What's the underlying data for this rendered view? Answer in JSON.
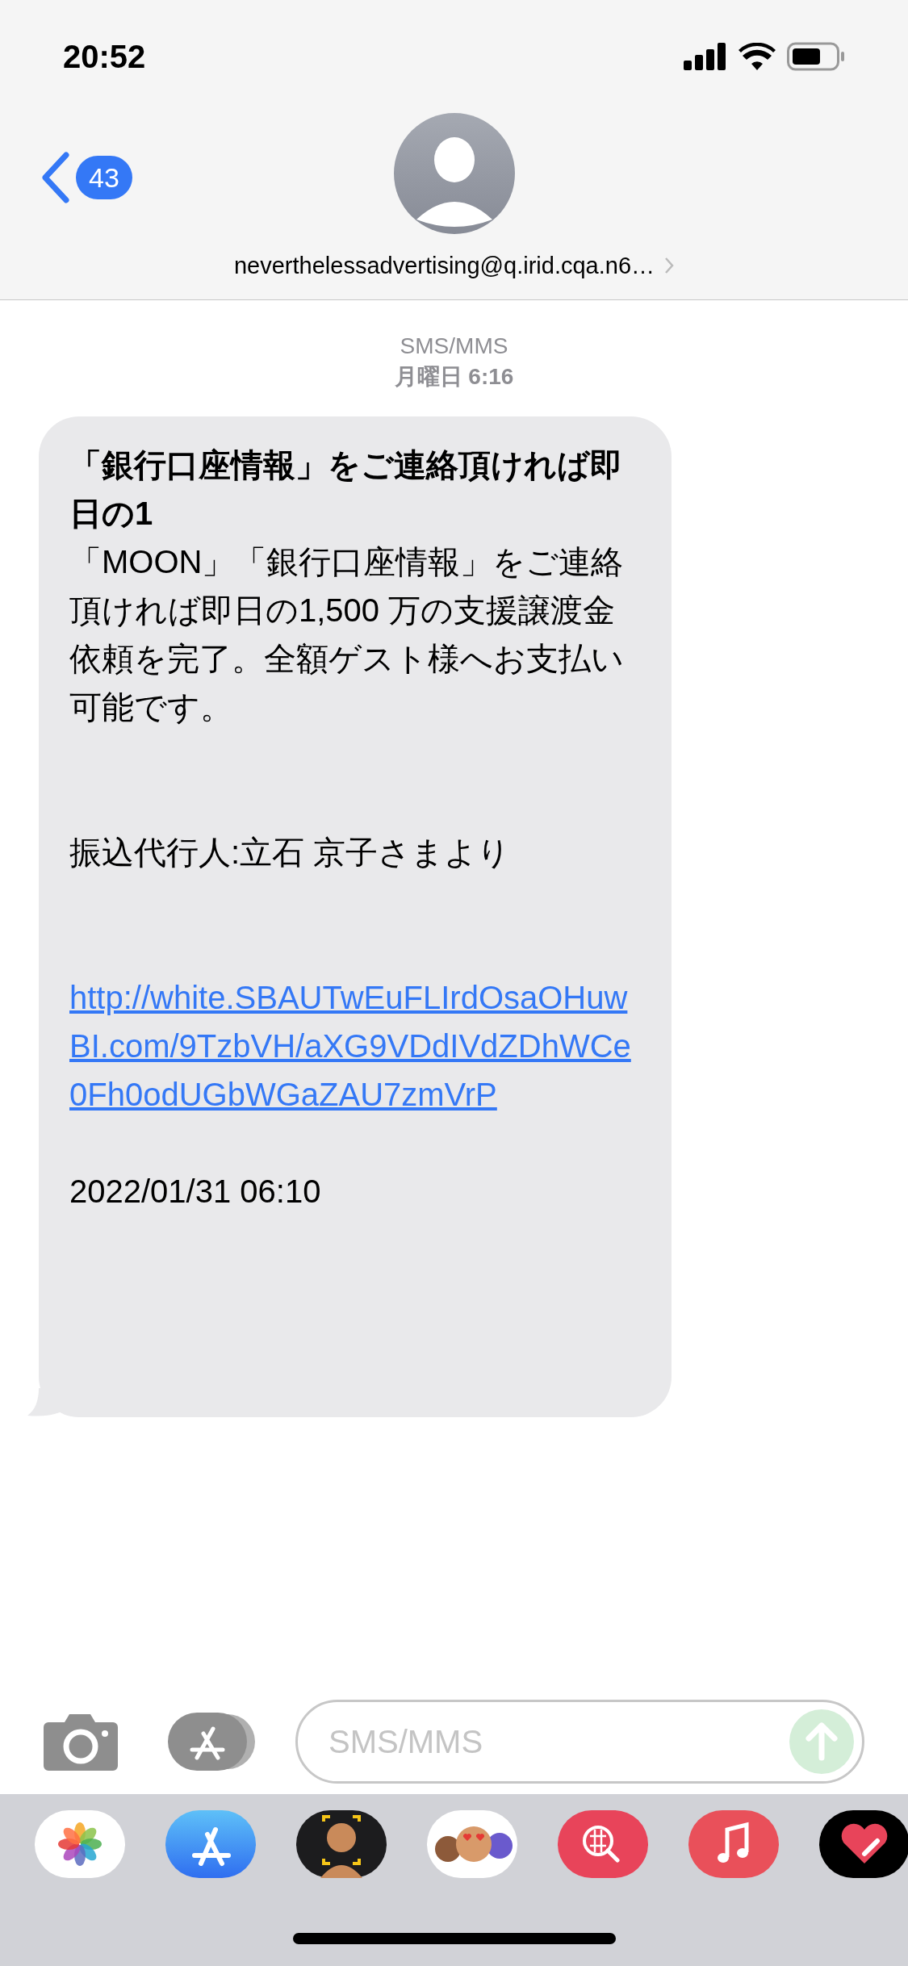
{
  "status_bar": {
    "time": "20:52"
  },
  "header": {
    "back_badge": "43",
    "contact": "neverthelessadvertising@q.irid.cqa.n6…"
  },
  "conversation": {
    "service": "SMS/MMS",
    "date": "月曜日 6:16",
    "message": {
      "subject": "「銀行口座情報」をご連絡頂ければ即日の1",
      "body": "「MOON」「銀行口座情報」をご連絡頂ければ即日の1,500 万の支援譲渡金依頼を完了。全額ゲスト様へお支払い可能です。",
      "sender": "振込代行人:立石 京子さまより",
      "link": "http://white.SBAUTwEuFLIrdOsaOHuwBI.com/9TzbVH/aXG9VDdIVdZDhWCe0Fh0odUGbWGaZAU7zmVrP",
      "timestamp": "2022/01/31 06:10"
    }
  },
  "composer": {
    "placeholder": "SMS/MMS"
  }
}
